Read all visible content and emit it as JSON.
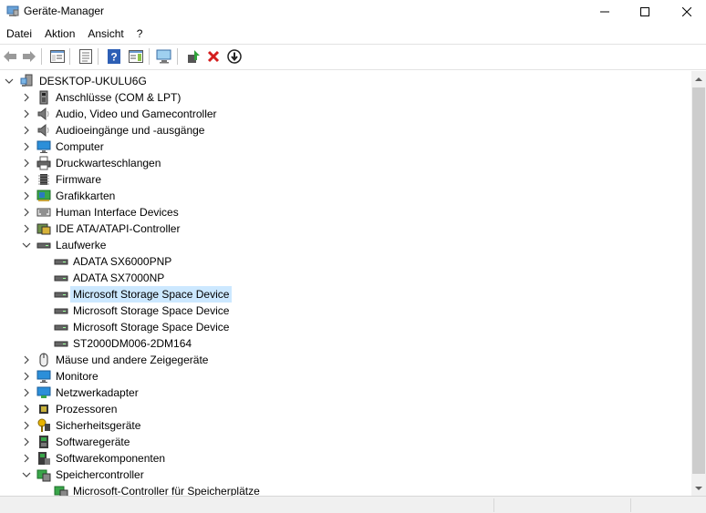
{
  "window": {
    "title": "Geräte-Manager",
    "minimize_glyph": "—",
    "maximize_glyph": "☐",
    "close_glyph": "✕"
  },
  "menu": [
    "Datei",
    "Aktion",
    "Ansicht",
    "?"
  ],
  "toolbar": {
    "icons": [
      "back-arrow-icon",
      "forward-arrow-icon",
      "show-hide-tree-icon",
      "properties-icon",
      "help-icon",
      "show-hide-action-pane-icon",
      "scan-hardware-icon",
      "update-driver-icon",
      "uninstall-device-icon",
      "disable-device-icon"
    ]
  },
  "tree": {
    "root": "DESKTOP-UKULU6G",
    "categories": [
      {
        "label": "Anschlüsse (COM & LPT)",
        "icon": "port-icon",
        "expanded": false
      },
      {
        "label": "Audio, Video und Gamecontroller",
        "icon": "speaker-icon",
        "expanded": false
      },
      {
        "label": "Audioeingänge und -ausgänge",
        "icon": "speaker-icon",
        "expanded": false
      },
      {
        "label": "Computer",
        "icon": "monitor-icon",
        "expanded": false
      },
      {
        "label": "Druckwarteschlangen",
        "icon": "printer-icon",
        "expanded": false
      },
      {
        "label": "Firmware",
        "icon": "chip-icon",
        "expanded": false
      },
      {
        "label": "Grafikkarten",
        "icon": "display-adapter-icon",
        "expanded": false
      },
      {
        "label": "Human Interface Devices",
        "icon": "keyboard-icon",
        "expanded": false
      },
      {
        "label": "IDE ATA/ATAPI-Controller",
        "icon": "ide-controller-icon",
        "expanded": false
      },
      {
        "label": "Laufwerke",
        "icon": "disk-drive-icon",
        "expanded": true,
        "children": [
          {
            "label": "ADATA SX6000PNP",
            "selected": false
          },
          {
            "label": "ADATA SX7000NP",
            "selected": false
          },
          {
            "label": "Microsoft Storage Space Device",
            "selected": true
          },
          {
            "label": "Microsoft Storage Space Device",
            "selected": false
          },
          {
            "label": "Microsoft Storage Space Device",
            "selected": false
          },
          {
            "label": "ST2000DM006-2DM164",
            "selected": false
          }
        ]
      },
      {
        "label": "Mäuse und andere Zeigegeräte",
        "icon": "mouse-icon",
        "expanded": false
      },
      {
        "label": "Monitore",
        "icon": "monitor-icon",
        "expanded": false
      },
      {
        "label": "Netzwerkadapter",
        "icon": "network-adapter-icon",
        "expanded": false
      },
      {
        "label": "Prozessoren",
        "icon": "processor-icon",
        "expanded": false
      },
      {
        "label": "Sicherheitsgeräte",
        "icon": "security-key-icon",
        "expanded": false
      },
      {
        "label": "Softwaregeräte",
        "icon": "software-device-icon",
        "expanded": false
      },
      {
        "label": "Softwarekomponenten",
        "icon": "software-component-icon",
        "expanded": false
      },
      {
        "label": "Speichercontroller",
        "icon": "storage-controller-icon",
        "expanded": true,
        "children": [
          {
            "label": "Microsoft-Controller für Speicherplätze",
            "selected": false
          }
        ]
      }
    ]
  },
  "colors": {
    "selection": "#cce8ff",
    "accent_blue": "#2b79d6",
    "delete_red": "#d41e1e",
    "green": "#2fa33a"
  }
}
